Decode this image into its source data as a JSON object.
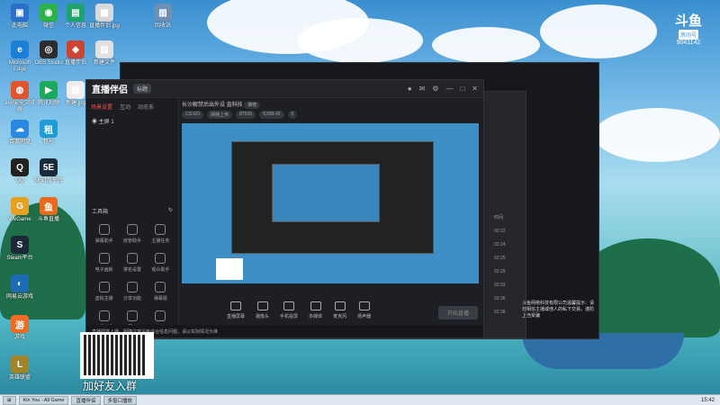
{
  "desktop_icons": [
    {
      "label": "此电脑",
      "color": "#2a6fc9",
      "glyph": "▣"
    },
    {
      "label": "微信",
      "color": "#2bb34a",
      "glyph": "◉"
    },
    {
      "label": "个人信息",
      "color": "#1fa36e",
      "glyph": "▤"
    },
    {
      "label": "直播伴侣.jpg",
      "color": "#d9d9d9",
      "glyph": "▦"
    },
    {
      "label": "回收站",
      "color": "#6c8fb5",
      "glyph": "▥"
    },
    {
      "label": "Microsoft Edge",
      "color": "#1b7fd6",
      "glyph": "e"
    },
    {
      "label": "OBS Studio",
      "color": "#2d2d2d",
      "glyph": "◎"
    },
    {
      "label": "直播伴侣",
      "color": "#cc4433",
      "glyph": "◈"
    },
    {
      "label": "新建文件",
      "color": "#e0e0e0",
      "glyph": "▧"
    },
    {
      "label": "360安全浏览器",
      "color": "#e0552b",
      "glyph": "◍"
    },
    {
      "label": "腾讯视频",
      "color": "#1aaa5a",
      "glyph": "▶"
    },
    {
      "label": "新建.jpg",
      "color": "#eeeeee",
      "glyph": "▨"
    },
    {
      "label": "百度网盘",
      "color": "#2a88e0",
      "glyph": "☁"
    },
    {
      "label": "租号",
      "color": "#1f9cd6",
      "glyph": "租"
    },
    {
      "label": "QQ",
      "color": "#222222",
      "glyph": "Q"
    },
    {
      "label": "5E对战平台",
      "color": "#1a2a3a",
      "glyph": "5E"
    },
    {
      "label": "WeGame",
      "color": "#e8a020",
      "glyph": "G"
    },
    {
      "label": "斗鱼直播",
      "color": "#e86a1a",
      "glyph": "鱼"
    },
    {
      "label": "Steam平台",
      "color": "#1b2838",
      "glyph": "S"
    },
    {
      "label": "网易云游戏",
      "color": "#1d6bb5",
      "glyph": "◐"
    },
    {
      "label": "游戏",
      "color": "#ef6b1f",
      "glyph": "游"
    },
    {
      "label": "英雄联盟",
      "color": "#a0842a",
      "glyph": "L"
    }
  ],
  "brand": {
    "name": "斗鱼",
    "sub": "房间号",
    "room": "9041142"
  },
  "main_window": {
    "app_title": "直播伴侣",
    "badge": "标题",
    "sidebar_tabs": [
      "场景设置",
      "互动",
      "动态系"
    ],
    "scene_item": "主屏 1",
    "tools_title": "工具箱",
    "tools": [
      "弹幕助手",
      "房管助手",
      "主播任务",
      "电子画板",
      "排名设置",
      "观众助手",
      "虚拟主播",
      "分享功能",
      "弹幕姬",
      "主播工具",
      "更多",
      ""
    ],
    "stream_title": "长沙解禁后出外设 直科技",
    "stream_tag": "推荐",
    "pills": [
      "CS:GO",
      "网络上传",
      "87915",
      "9,090,42",
      "0"
    ],
    "controls": [
      "直播屏幕",
      "摄像头",
      "手机投屏",
      "多媒体",
      "麦克风",
      "扬声器"
    ],
    "start_button": "开始直播",
    "status_text": "直播即将上播，明确注意设备综合信息问题，请以实际情况为准"
  },
  "right_panel": {
    "header": "时间",
    "times": [
      "02:22",
      "02:24",
      "02:25",
      "02:29",
      "02:33",
      "02:36",
      "02:38"
    ],
    "notice": "斗鱼网络科技有限公司温馨提示：请勿相信主播或他人的私下交易，谨防上当受骗"
  },
  "qr_caption": "加好友入群",
  "taskbar": {
    "items": [
      "Kin You - All Game",
      "直播伴侣",
      "多窗口播放"
    ],
    "clock": "15:42"
  }
}
